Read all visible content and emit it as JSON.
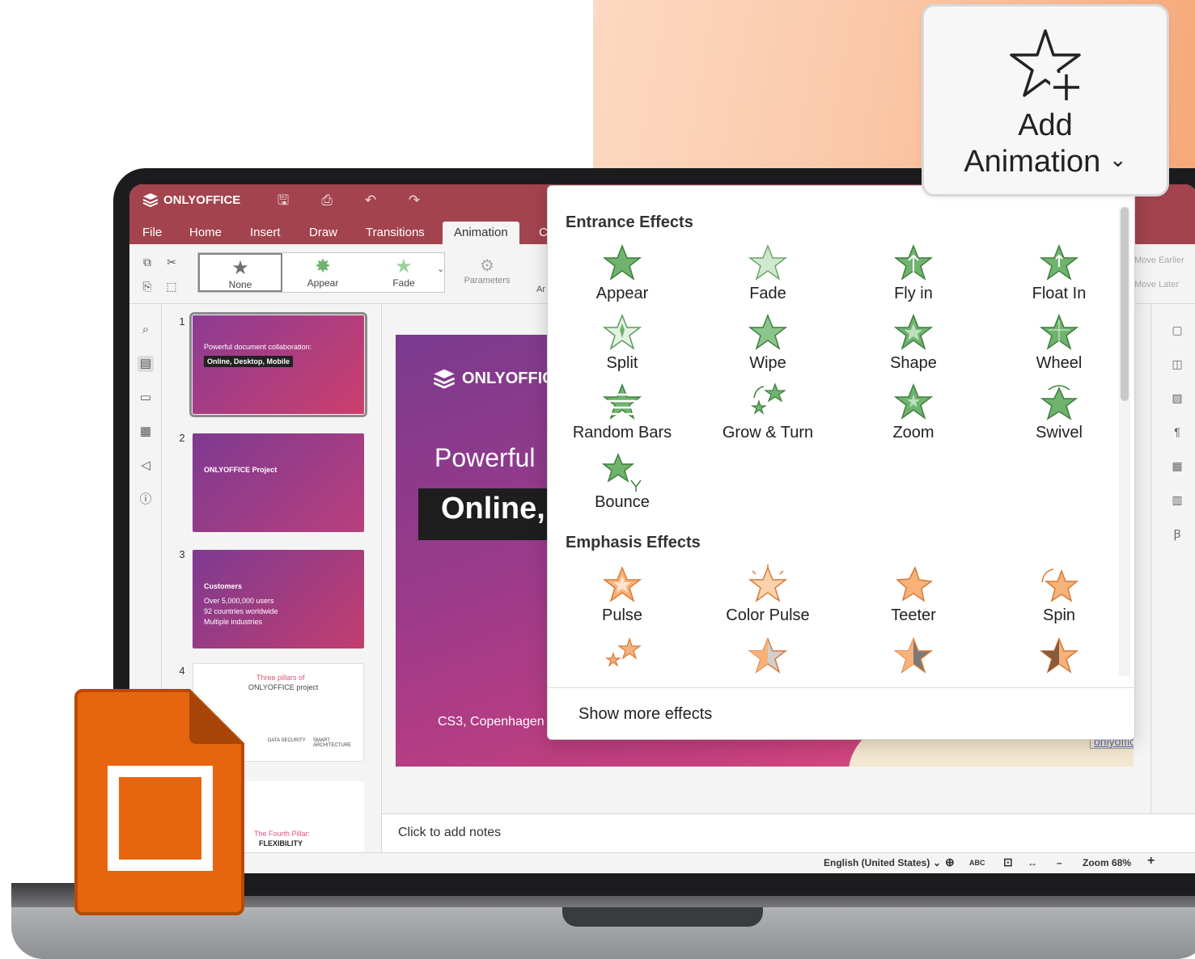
{
  "app": {
    "brand": "ONLYOFFICE",
    "menu_tabs": [
      "File",
      "Home",
      "Insert",
      "Draw",
      "Transitions",
      "Animation",
      "C"
    ],
    "active_tab": "Animation"
  },
  "toolbar": {
    "gallery": [
      {
        "label": "None",
        "icon": "star-gray-icon"
      },
      {
        "label": "Appear",
        "icon": "star-green-icon"
      },
      {
        "label": "Fade",
        "icon": "star-green-light-icon"
      }
    ],
    "parameters_label": "Parameters",
    "partial_label": "Ar",
    "move_earlier": "Move Earlier",
    "move_later": "Move Later"
  },
  "thumbnails": [
    {
      "num": "1",
      "title": "Powerful document collaboration:",
      "line2": "Online, Desktop, Mobile"
    },
    {
      "num": "2",
      "title": "ONLYOFFICE Project"
    },
    {
      "num": "3",
      "title": "Customers",
      "lines": [
        "Over 5,000,000 users",
        "92 countries worldwide",
        "Multiple industries"
      ]
    },
    {
      "num": "4",
      "title": "Three pillars of",
      "subtitle": "ONLYOFFICE project",
      "pillars": [
        "DATA SECURITY",
        "SMART ARCHITECTURE"
      ]
    },
    {
      "num": "",
      "title": "The Fourth Pillar:",
      "subtitle": "FLEXIBILITY"
    }
  ],
  "slide": {
    "logo": "ONLYOFFIC",
    "heading": "Powerful",
    "box_text": "Online,",
    "footer": "CS3, Copenhagen",
    "link_fragment": "onlyoffice.com"
  },
  "notes": {
    "placeholder": "Click to add notes"
  },
  "status": {
    "language": "English (United States)",
    "zoom": "Zoom 68%",
    "minus": "–",
    "plus": "+"
  },
  "popup": {
    "entrance_title": "Entrance Effects",
    "entrance": [
      "Appear",
      "Fade",
      "Fly in",
      "Float In",
      "Split",
      "Wipe",
      "Shape",
      "Wheel",
      "Random Bars",
      "Grow & Turn",
      "Zoom",
      "Swivel",
      "Bounce"
    ],
    "emphasis_title": "Emphasis Effects",
    "emphasis": [
      "Pulse",
      "Color Pulse",
      "Teeter",
      "Spin"
    ],
    "show_more": "Show more effects"
  },
  "callout": {
    "line1": "Add",
    "line2": "Animation",
    "chevron": "⌄"
  },
  "colors": {
    "brand": "#a3434e",
    "entrance_star": "#6fb36f",
    "emphasis_star": "#f4a46a",
    "badge": "#e8650f"
  }
}
